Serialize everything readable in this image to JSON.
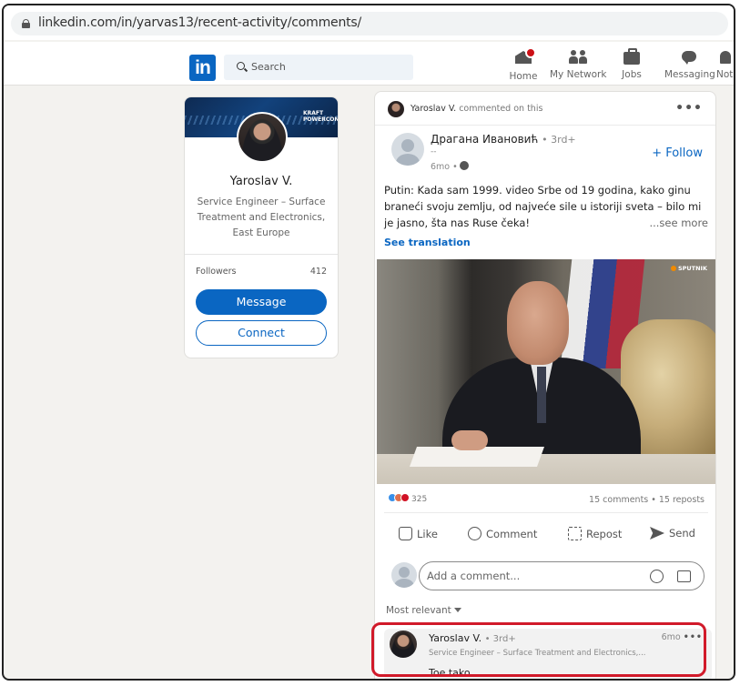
{
  "browser": {
    "url": "linkedin.com/in/yarvas13/recent-activity/comments/"
  },
  "nav": {
    "logo": "in",
    "search_placeholder": "Search",
    "items": [
      {
        "label": "Home",
        "icon": "home-icon"
      },
      {
        "label": "My Network",
        "icon": "network-icon"
      },
      {
        "label": "Jobs",
        "icon": "jobs-icon"
      },
      {
        "label": "Messaging",
        "icon": "messaging-icon"
      },
      {
        "label": "Notifi",
        "icon": "notifications-icon"
      }
    ]
  },
  "profile": {
    "cover_brand": "KRAFT POWERCON",
    "name": "Yaroslav V.",
    "title": "Service Engineer – Surface Treatment and Electronics, East Europe",
    "followers_label": "Followers",
    "followers_count": "412",
    "message_label": "Message",
    "connect_label": "Connect"
  },
  "post": {
    "activity_actor": "Yaroslav V.",
    "activity_text": "commented on this",
    "author_name": "Драгана Ивановић",
    "author_degree": "• 3rd+",
    "author_subtitle": "--",
    "time": "6mo •",
    "follow_label": "+ Follow",
    "text": "Putin: Kada sam 1999. video Srbe od 19 godina, kako ginu braneći svoju zemlju, od najveće sile u istoriji sveta – bilo mi je jasno, šta nas Ruse čeka!",
    "see_more": "...see more",
    "see_translation": "See translation",
    "image_watermark": "SPUTNIK",
    "reaction_count": "325",
    "reaction_colors": [
      "#378fe9",
      "#df704d",
      "#d11124"
    ],
    "stats": "15 comments • 15 reposts",
    "actions": [
      {
        "label": "Like",
        "icon": "like-icon"
      },
      {
        "label": "Comment",
        "icon": "comment-icon"
      },
      {
        "label": "Repost",
        "icon": "repost-icon"
      },
      {
        "label": "Send",
        "icon": "send-icon"
      }
    ],
    "comment_placeholder": "Add a comment...",
    "sort_label": "Most relevant",
    "comment": {
      "author": "Yaroslav V.",
      "degree": "• 3rd+",
      "time": "6mo",
      "subtitle": "Service Engineer – Surface Treatment and Electronics,...",
      "text": "Toe tako"
    }
  },
  "colors": {
    "brand": "#0a66c2",
    "highlight": "#d11a2a"
  }
}
